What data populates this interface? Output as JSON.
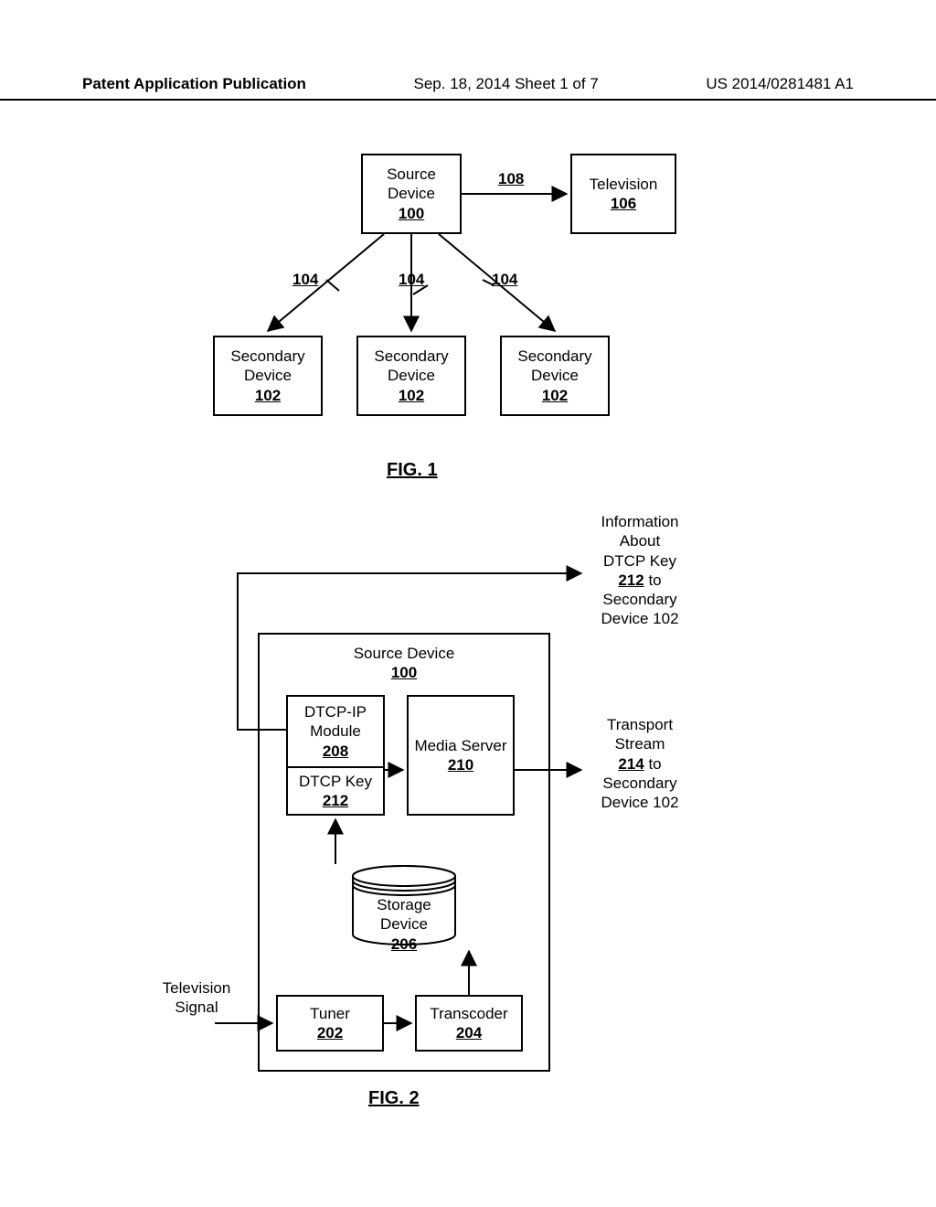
{
  "header": {
    "left": "Patent Application Publication",
    "center": "Sep. 18, 2014  Sheet 1 of 7",
    "right": "US 2014/0281481 A1"
  },
  "fig1": {
    "source_device": {
      "line1": "Source",
      "line2": "Device",
      "ref": "100"
    },
    "television": {
      "line1": "Television",
      "ref": "106"
    },
    "link_108": "108",
    "link_104": "104",
    "secondary": {
      "line1": "Secondary",
      "line2": "Device",
      "ref": "102"
    },
    "caption": "FIG. 1"
  },
  "fig2": {
    "title_line": "Source Device",
    "title_ref": "100",
    "dtcp_module": {
      "line1": "DTCP-IP",
      "line2": "Module",
      "ref": "208"
    },
    "dtcp_key": {
      "line1": "DTCP Key",
      "ref": "212"
    },
    "media_server": {
      "line1": "Media Server",
      "ref": "210"
    },
    "storage": {
      "line1": "Storage",
      "line2": "Device",
      "ref": "206"
    },
    "tuner": {
      "line1": "Tuner",
      "ref": "202"
    },
    "transcoder": {
      "line1": "Transcoder",
      "ref": "204"
    },
    "tv_signal": {
      "line1": "Television",
      "line2": "Signal"
    },
    "info_out": {
      "line1": "Information",
      "line2": "About",
      "line3": "DTCP Key",
      "ref": "212",
      "line5": "to",
      "line6": "Secondary",
      "line7": "Device 102"
    },
    "ts_out": {
      "line1": "Transport",
      "line2": "Stream",
      "ref": "214",
      "line4": "to",
      "line5": "Secondary",
      "line6": "Device 102"
    },
    "caption": "FIG. 2"
  }
}
